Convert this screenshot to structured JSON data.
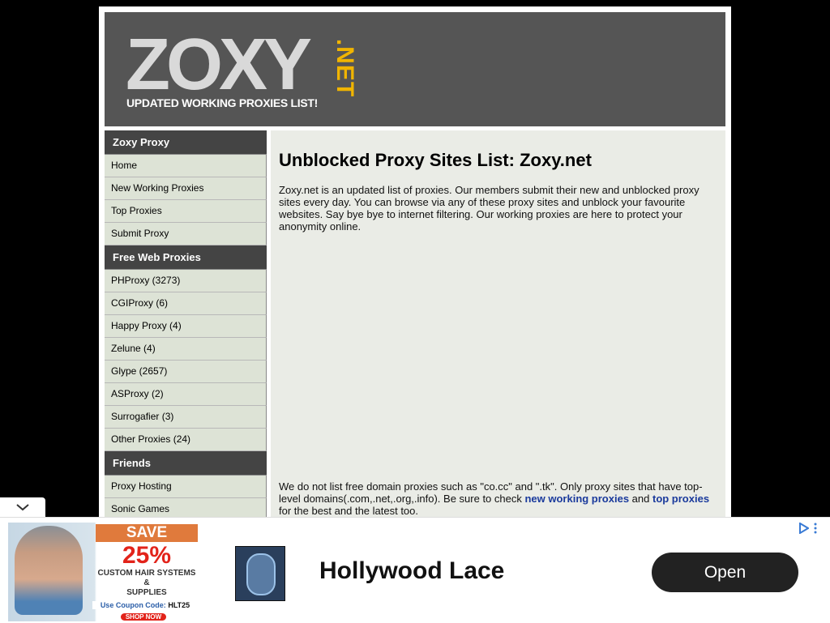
{
  "header": {
    "logo_main": "ZOXY",
    "logo_suffix": ".NET",
    "tagline": "UPDATED WORKING PROXIES LIST!"
  },
  "sidebar": {
    "sections": [
      {
        "title": "Zoxy Proxy",
        "items": [
          "Home",
          "New Working Proxies",
          "Top Proxies",
          "Submit Proxy"
        ]
      },
      {
        "title": "Free Web Proxies",
        "items": [
          "PHProxy (3273)",
          "CGIProxy (6)",
          "Happy Proxy (4)",
          "Zelune (4)",
          "Glype (2657)",
          "ASProxy (2)",
          "Surrogafier (3)",
          "Other Proxies (24)"
        ]
      },
      {
        "title": "Friends",
        "items": [
          "Proxy Hosting",
          "Sonic Games"
        ]
      }
    ]
  },
  "main": {
    "title": "Unblocked Proxy Sites List: Zoxy.net",
    "intro": "Zoxy.net is an updated list of proxies. Our members submit their new and unblocked proxy sites every day. You can browse via any of these proxy sites and unblock your favourite websites. Say bye bye to internet filtering. Our working proxies are here to protect your anonymity online.",
    "note_before": "We do not list free domain proxies such as \"co.cc\" and \".tk\". Only proxy sites that have top-level domains(.com,.net,.org,.info). Be sure to check ",
    "note_link1": "new working proxies",
    "note_mid": " and ",
    "note_link2": "top proxies",
    "note_after": " for the best and the latest too."
  },
  "ad": {
    "save": "SAVE",
    "percent": "25%",
    "line1": "CUSTOM HAIR SYSTEMS",
    "line2": "&",
    "line3": "SUPPLIES",
    "coupon_label": "Use Coupon Code:",
    "coupon_code": "HLT25",
    "shop": "SHOP NOW",
    "title": "Hollywood Lace",
    "open_button": "Open"
  },
  "colors": {
    "header_bg": "#555555",
    "logo_accent": "#f0b400",
    "sidebar_head": "#444444",
    "sidebar_item": "#dde3d6",
    "main_bg": "#eaece6",
    "link": "#1a3a9c"
  }
}
